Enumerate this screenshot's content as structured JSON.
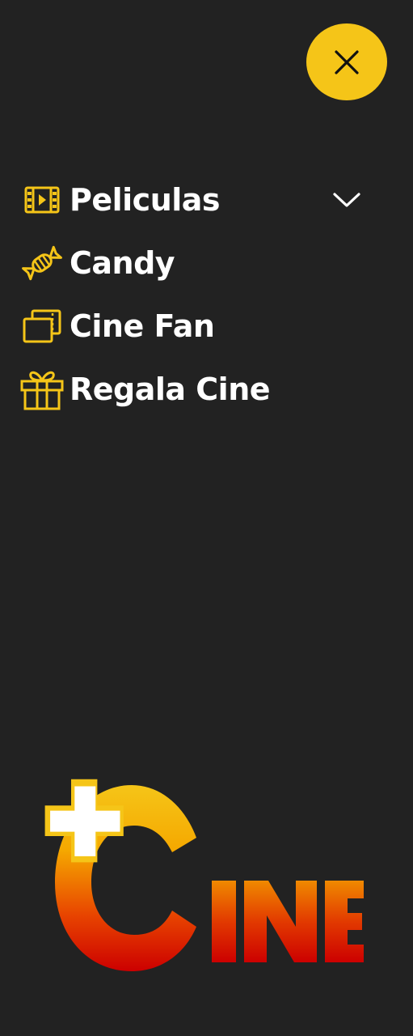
{
  "menu": {
    "items": [
      {
        "label": "Peliculas",
        "icon": "film-icon",
        "has_dropdown": true
      },
      {
        "label": "Candy",
        "icon": "candy-icon",
        "has_dropdown": false
      },
      {
        "label": "Cine Fan",
        "icon": "cards-icon",
        "has_dropdown": false
      },
      {
        "label": "Regala Cine",
        "icon": "gift-icon",
        "has_dropdown": false
      }
    ]
  },
  "close_button": {
    "icon": "close-icon"
  },
  "logo": {
    "text": "CINE",
    "icon": "plus-cine-logo"
  },
  "colors": {
    "background": "#222222",
    "accent": "#f5c518",
    "text": "#ffffff",
    "logo_red": "#d40000",
    "logo_orange": "#f08a00"
  }
}
